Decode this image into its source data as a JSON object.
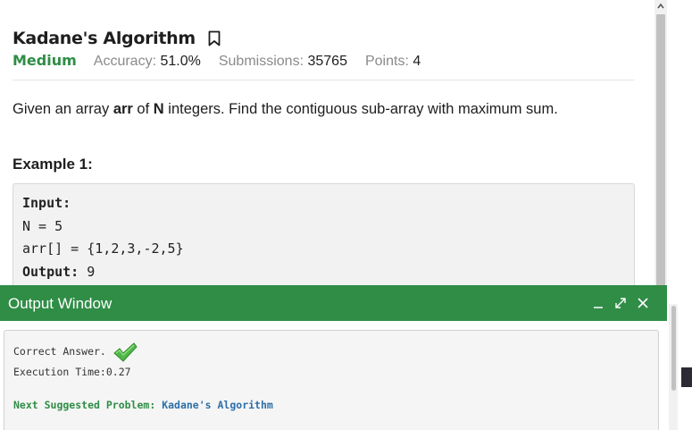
{
  "problem": {
    "title": "Kadane's Algorithm",
    "difficulty": "Medium",
    "accuracy_label": "Accuracy:",
    "accuracy_value": "51.0%",
    "submissions_label": "Submissions:",
    "submissions_value": "35765",
    "points_label": "Points:",
    "points_value": "4",
    "statement_parts": [
      "Given an array ",
      "arr",
      " of ",
      "N",
      " integers. Find the contiguous sub-array with maximum sum."
    ],
    "example_heading": "Example 1:",
    "example": {
      "input_label": "Input:",
      "line_n": "N = 5",
      "line_arr": "arr[] = {1,2,3,-2,5}",
      "output_label": "Output:",
      "output_value": " 9"
    }
  },
  "output_window": {
    "title": "Output Window",
    "result_text": "Correct Answer.",
    "execution_time": "Execution Time:0.27",
    "next_label": "Next Suggested Problem:",
    "next_link": "Kadane's Algorithm"
  },
  "icons": [
    "bookmark-icon",
    "minimize-icon",
    "expand-icon",
    "close-icon",
    "checkmark-icon"
  ],
  "colors": {
    "accent_green": "#2f8d46",
    "link_blue": "#2d6fa8"
  }
}
